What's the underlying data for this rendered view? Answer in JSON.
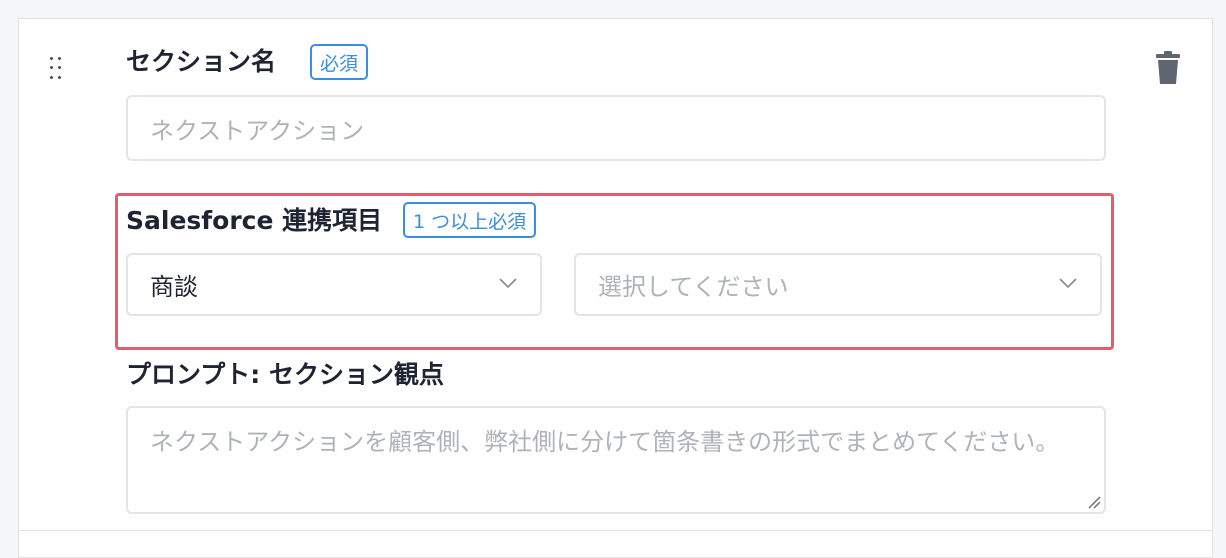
{
  "section_name": {
    "label": "セクション名",
    "required_badge": "必須",
    "input_placeholder": "ネクストアクション"
  },
  "salesforce": {
    "label": "Salesforce 連携項目",
    "required_badge": "1 つ以上必須",
    "object_select_value": "商談",
    "field_select_placeholder": "選択してください"
  },
  "prompt": {
    "label": "プロンプト: セクション観点",
    "textarea_placeholder": "ネクストアクションを顧客側、弊社側に分けて箇条書きの形式でまとめてください。"
  },
  "icons": {
    "drag": "drag-handle-icon",
    "delete": "trash-icon",
    "chevron": "chevron-down-icon",
    "resize": "resize-grip-icon"
  },
  "colors": {
    "accent": "#3a8ee6",
    "highlight_border": "#e35d6c",
    "placeholder": "#aeb3ba",
    "text": "#1f2433"
  }
}
